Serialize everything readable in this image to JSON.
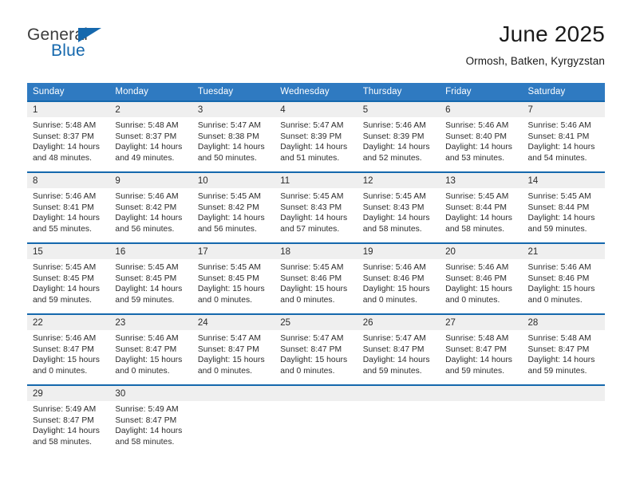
{
  "brand": {
    "name_part1": "General",
    "name_part2": "Blue",
    "logo_icon": "blue-triangle-icon"
  },
  "header": {
    "title": "June 2025",
    "location": "Ormosh, Batken, Kyrgyzstan"
  },
  "colors": {
    "header_blue": "#2f7ac1",
    "row_border_blue": "#1568ad",
    "daynum_band": "#efefef",
    "brand_blue": "#1568ad",
    "text": "#2b2b2b"
  },
  "labels": {
    "sunrise_prefix": "Sunrise:",
    "sunset_prefix": "Sunset:",
    "daylight_prefix": "Daylight:"
  },
  "calendar": {
    "day_headers": [
      "Sunday",
      "Monday",
      "Tuesday",
      "Wednesday",
      "Thursday",
      "Friday",
      "Saturday"
    ],
    "weeks": [
      [
        {
          "day": "1",
          "sunrise": "Sunrise: 5:48 AM",
          "sunset": "Sunset: 8:37 PM",
          "daylight_line1": "Daylight: 14 hours",
          "daylight_line2": "and 48 minutes."
        },
        {
          "day": "2",
          "sunrise": "Sunrise: 5:48 AM",
          "sunset": "Sunset: 8:37 PM",
          "daylight_line1": "Daylight: 14 hours",
          "daylight_line2": "and 49 minutes."
        },
        {
          "day": "3",
          "sunrise": "Sunrise: 5:47 AM",
          "sunset": "Sunset: 8:38 PM",
          "daylight_line1": "Daylight: 14 hours",
          "daylight_line2": "and 50 minutes."
        },
        {
          "day": "4",
          "sunrise": "Sunrise: 5:47 AM",
          "sunset": "Sunset: 8:39 PM",
          "daylight_line1": "Daylight: 14 hours",
          "daylight_line2": "and 51 minutes."
        },
        {
          "day": "5",
          "sunrise": "Sunrise: 5:46 AM",
          "sunset": "Sunset: 8:39 PM",
          "daylight_line1": "Daylight: 14 hours",
          "daylight_line2": "and 52 minutes."
        },
        {
          "day": "6",
          "sunrise": "Sunrise: 5:46 AM",
          "sunset": "Sunset: 8:40 PM",
          "daylight_line1": "Daylight: 14 hours",
          "daylight_line2": "and 53 minutes."
        },
        {
          "day": "7",
          "sunrise": "Sunrise: 5:46 AM",
          "sunset": "Sunset: 8:41 PM",
          "daylight_line1": "Daylight: 14 hours",
          "daylight_line2": "and 54 minutes."
        }
      ],
      [
        {
          "day": "8",
          "sunrise": "Sunrise: 5:46 AM",
          "sunset": "Sunset: 8:41 PM",
          "daylight_line1": "Daylight: 14 hours",
          "daylight_line2": "and 55 minutes."
        },
        {
          "day": "9",
          "sunrise": "Sunrise: 5:46 AM",
          "sunset": "Sunset: 8:42 PM",
          "daylight_line1": "Daylight: 14 hours",
          "daylight_line2": "and 56 minutes."
        },
        {
          "day": "10",
          "sunrise": "Sunrise: 5:45 AM",
          "sunset": "Sunset: 8:42 PM",
          "daylight_line1": "Daylight: 14 hours",
          "daylight_line2": "and 56 minutes."
        },
        {
          "day": "11",
          "sunrise": "Sunrise: 5:45 AM",
          "sunset": "Sunset: 8:43 PM",
          "daylight_line1": "Daylight: 14 hours",
          "daylight_line2": "and 57 minutes."
        },
        {
          "day": "12",
          "sunrise": "Sunrise: 5:45 AM",
          "sunset": "Sunset: 8:43 PM",
          "daylight_line1": "Daylight: 14 hours",
          "daylight_line2": "and 58 minutes."
        },
        {
          "day": "13",
          "sunrise": "Sunrise: 5:45 AM",
          "sunset": "Sunset: 8:44 PM",
          "daylight_line1": "Daylight: 14 hours",
          "daylight_line2": "and 58 minutes."
        },
        {
          "day": "14",
          "sunrise": "Sunrise: 5:45 AM",
          "sunset": "Sunset: 8:44 PM",
          "daylight_line1": "Daylight: 14 hours",
          "daylight_line2": "and 59 minutes."
        }
      ],
      [
        {
          "day": "15",
          "sunrise": "Sunrise: 5:45 AM",
          "sunset": "Sunset: 8:45 PM",
          "daylight_line1": "Daylight: 14 hours",
          "daylight_line2": "and 59 minutes."
        },
        {
          "day": "16",
          "sunrise": "Sunrise: 5:45 AM",
          "sunset": "Sunset: 8:45 PM",
          "daylight_line1": "Daylight: 14 hours",
          "daylight_line2": "and 59 minutes."
        },
        {
          "day": "17",
          "sunrise": "Sunrise: 5:45 AM",
          "sunset": "Sunset: 8:45 PM",
          "daylight_line1": "Daylight: 15 hours",
          "daylight_line2": "and 0 minutes."
        },
        {
          "day": "18",
          "sunrise": "Sunrise: 5:45 AM",
          "sunset": "Sunset: 8:46 PM",
          "daylight_line1": "Daylight: 15 hours",
          "daylight_line2": "and 0 minutes."
        },
        {
          "day": "19",
          "sunrise": "Sunrise: 5:46 AM",
          "sunset": "Sunset: 8:46 PM",
          "daylight_line1": "Daylight: 15 hours",
          "daylight_line2": "and 0 minutes."
        },
        {
          "day": "20",
          "sunrise": "Sunrise: 5:46 AM",
          "sunset": "Sunset: 8:46 PM",
          "daylight_line1": "Daylight: 15 hours",
          "daylight_line2": "and 0 minutes."
        },
        {
          "day": "21",
          "sunrise": "Sunrise: 5:46 AM",
          "sunset": "Sunset: 8:46 PM",
          "daylight_line1": "Daylight: 15 hours",
          "daylight_line2": "and 0 minutes."
        }
      ],
      [
        {
          "day": "22",
          "sunrise": "Sunrise: 5:46 AM",
          "sunset": "Sunset: 8:47 PM",
          "daylight_line1": "Daylight: 15 hours",
          "daylight_line2": "and 0 minutes."
        },
        {
          "day": "23",
          "sunrise": "Sunrise: 5:46 AM",
          "sunset": "Sunset: 8:47 PM",
          "daylight_line1": "Daylight: 15 hours",
          "daylight_line2": "and 0 minutes."
        },
        {
          "day": "24",
          "sunrise": "Sunrise: 5:47 AM",
          "sunset": "Sunset: 8:47 PM",
          "daylight_line1": "Daylight: 15 hours",
          "daylight_line2": "and 0 minutes."
        },
        {
          "day": "25",
          "sunrise": "Sunrise: 5:47 AM",
          "sunset": "Sunset: 8:47 PM",
          "daylight_line1": "Daylight: 15 hours",
          "daylight_line2": "and 0 minutes."
        },
        {
          "day": "26",
          "sunrise": "Sunrise: 5:47 AM",
          "sunset": "Sunset: 8:47 PM",
          "daylight_line1": "Daylight: 14 hours",
          "daylight_line2": "and 59 minutes."
        },
        {
          "day": "27",
          "sunrise": "Sunrise: 5:48 AM",
          "sunset": "Sunset: 8:47 PM",
          "daylight_line1": "Daylight: 14 hours",
          "daylight_line2": "and 59 minutes."
        },
        {
          "day": "28",
          "sunrise": "Sunrise: 5:48 AM",
          "sunset": "Sunset: 8:47 PM",
          "daylight_line1": "Daylight: 14 hours",
          "daylight_line2": "and 59 minutes."
        }
      ],
      [
        {
          "day": "29",
          "sunrise": "Sunrise: 5:49 AM",
          "sunset": "Sunset: 8:47 PM",
          "daylight_line1": "Daylight: 14 hours",
          "daylight_line2": "and 58 minutes."
        },
        {
          "day": "30",
          "sunrise": "Sunrise: 5:49 AM",
          "sunset": "Sunset: 8:47 PM",
          "daylight_line1": "Daylight: 14 hours",
          "daylight_line2": "and 58 minutes."
        },
        {
          "day": "",
          "sunrise": "",
          "sunset": "",
          "daylight_line1": "",
          "daylight_line2": "",
          "empty": true
        },
        {
          "day": "",
          "sunrise": "",
          "sunset": "",
          "daylight_line1": "",
          "daylight_line2": "",
          "empty": true
        },
        {
          "day": "",
          "sunrise": "",
          "sunset": "",
          "daylight_line1": "",
          "daylight_line2": "",
          "empty": true
        },
        {
          "day": "",
          "sunrise": "",
          "sunset": "",
          "daylight_line1": "",
          "daylight_line2": "",
          "empty": true
        },
        {
          "day": "",
          "sunrise": "",
          "sunset": "",
          "daylight_line1": "",
          "daylight_line2": "",
          "empty": true
        }
      ]
    ]
  }
}
